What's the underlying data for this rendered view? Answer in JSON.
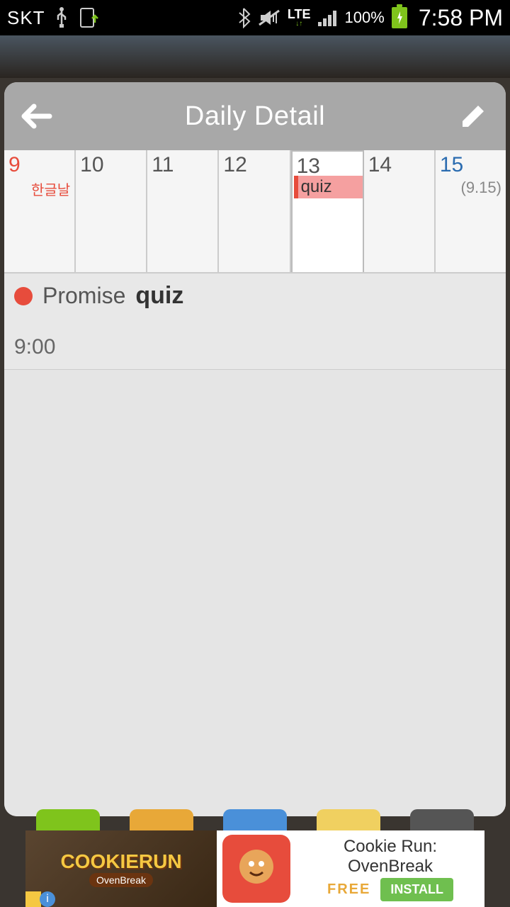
{
  "status": {
    "carrier": "SKT",
    "network": "LTE",
    "battery_pct": "100%",
    "time": "7:58 PM"
  },
  "modal": {
    "title": "Daily Detail"
  },
  "week": {
    "days": [
      {
        "num": "9",
        "sub": "한글날"
      },
      {
        "num": "10"
      },
      {
        "num": "11"
      },
      {
        "num": "12"
      },
      {
        "num": "13",
        "event": "quiz"
      },
      {
        "num": "14"
      },
      {
        "num": "15",
        "sub2": "(9.15)"
      }
    ]
  },
  "detail": {
    "category": "Promise",
    "event_name": "quiz",
    "time": "9:00"
  },
  "ad": {
    "logo_main": "COOKIERUN",
    "logo_sub": "OvenBreak",
    "title1": "Cookie Run:",
    "title2": "OvenBreak",
    "free": "FREE",
    "install": "INSTALL"
  }
}
